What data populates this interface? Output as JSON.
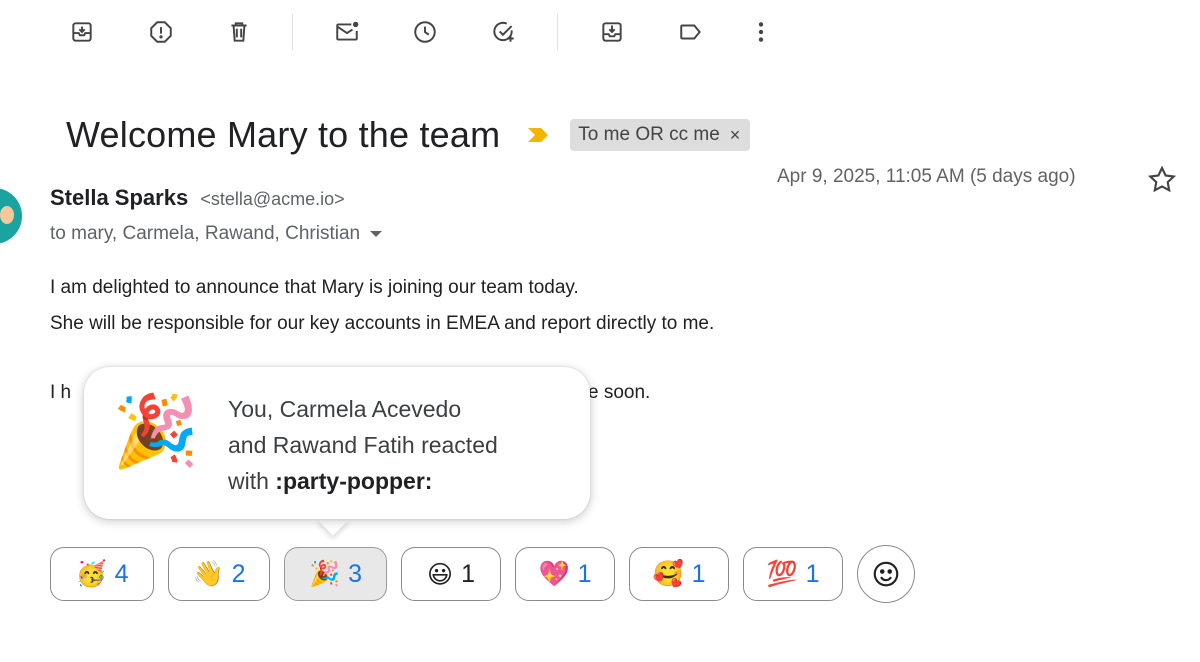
{
  "toolbar": {
    "buttons": [
      {
        "name": "archive-icon"
      },
      {
        "name": "report-spam-icon"
      },
      {
        "name": "delete-icon"
      },
      {
        "name": "mark-unread-icon"
      },
      {
        "name": "snooze-icon"
      },
      {
        "name": "add-to-tasks-icon"
      },
      {
        "name": "move-to-icon"
      },
      {
        "name": "label-icon"
      },
      {
        "name": "more-vert-icon"
      }
    ]
  },
  "email": {
    "subject": "Welcome Mary to the team",
    "importance_color": "#f4b400",
    "label_chip": {
      "text": "To me OR cc me",
      "close": "×"
    },
    "sender_name": "Stella Sparks",
    "sender_email": "<stella@acme.io>",
    "recipients": "to mary, Carmela, Rawand, Christian",
    "date": "Apr 9, 2025, 11:05 AM (5 days ago)",
    "body": {
      "line1": "I am delighted to announce that Mary is joining our team today.",
      "line2": "She will be responsible for our key accounts in EMEA and report directly to me.",
      "line3_visible_start": "I h",
      "line3_visible_end": "e soon."
    }
  },
  "tooltip": {
    "emoji": "🎉",
    "line1": "You, Carmela Acevedo",
    "line2": "and Rawand Fatih reacted",
    "line3_prefix": "with ",
    "line3_code": ":party-popper:"
  },
  "reactions": [
    {
      "emoji": "🥳",
      "count": "4",
      "active": false
    },
    {
      "emoji": "👋",
      "count": "2",
      "active": false
    },
    {
      "emoji": "🎉",
      "count": "3",
      "active": true
    },
    {
      "emoji": "😃",
      "count": "1",
      "active": false
    },
    {
      "emoji": "💖",
      "count": "1",
      "active": false
    },
    {
      "emoji": "🥰",
      "count": "1",
      "active": false
    },
    {
      "emoji": "💯",
      "count": "1",
      "active": false
    }
  ],
  "add_reaction_icon": "add-reaction-icon",
  "colors": {
    "accent_blue": "#1a73e8",
    "avatar_teal": "#1aa3a0"
  }
}
